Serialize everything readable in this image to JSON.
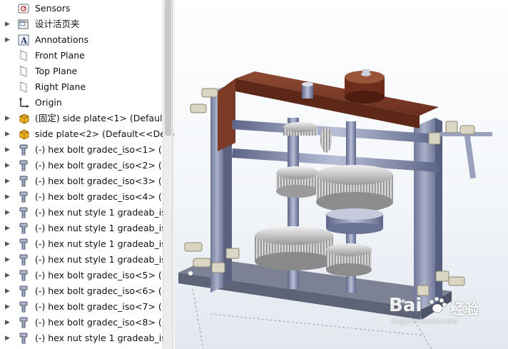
{
  "tree": {
    "items": [
      {
        "label": "Sensors",
        "icon": "sensors-folder-icon",
        "expander": "none"
      },
      {
        "label": "设计活页夹",
        "icon": "design-binder-icon",
        "expander": "collapsed"
      },
      {
        "label": "Annotations",
        "icon": "annotations-icon",
        "expander": "collapsed"
      },
      {
        "label": "Front Plane",
        "icon": "plane-icon",
        "expander": "none"
      },
      {
        "label": "Top Plane",
        "icon": "plane-icon",
        "expander": "none"
      },
      {
        "label": "Right Plane",
        "icon": "plane-icon",
        "expander": "none"
      },
      {
        "label": "Origin",
        "icon": "origin-icon",
        "expander": "none"
      },
      {
        "label": "(固定) side plate<1> (Default<",
        "icon": "part-icon",
        "expander": "collapsed"
      },
      {
        "label": "side plate<2> (Default<<Defa",
        "icon": "part-icon",
        "expander": "collapsed"
      },
      {
        "label": "(-) hex bolt gradec_iso<1> (IS(",
        "icon": "bolt-icon",
        "expander": "collapsed"
      },
      {
        "label": "(-) hex bolt gradec_iso<2> (IS(",
        "icon": "bolt-icon",
        "expander": "collapsed"
      },
      {
        "label": "(-) hex bolt gradec_iso<3> (IS(",
        "icon": "bolt-icon",
        "expander": "collapsed"
      },
      {
        "label": "(-) hex bolt gradec_iso<4> (IS(",
        "icon": "bolt-icon",
        "expander": "collapsed"
      },
      {
        "label": "(-) hex nut style 1 gradeab_iso",
        "icon": "bolt-icon",
        "expander": "collapsed"
      },
      {
        "label": "(-) hex nut style 1 gradeab_iso",
        "icon": "bolt-icon",
        "expander": "collapsed"
      },
      {
        "label": "(-) hex nut style 1 gradeab_iso",
        "icon": "bolt-icon",
        "expander": "collapsed"
      },
      {
        "label": "(-) hex nut style 1 gradeab_iso",
        "icon": "bolt-icon",
        "expander": "collapsed"
      },
      {
        "label": "(-) hex bolt gradec_iso<5> (IS(",
        "icon": "bolt-icon",
        "expander": "collapsed"
      },
      {
        "label": "(-) hex bolt gradec_iso<6> (IS(",
        "icon": "bolt-icon",
        "expander": "collapsed"
      },
      {
        "label": "(-) hex bolt gradec_iso<7> (IS(",
        "icon": "bolt-icon",
        "expander": "collapsed"
      },
      {
        "label": "(-) hex bolt gradec_iso<8> (IS(",
        "icon": "bolt-icon",
        "expander": "collapsed"
      },
      {
        "label": "(-) hex nut style 1 gradeab_iso",
        "icon": "bolt-icon",
        "expander": "collapsed"
      }
    ]
  },
  "watermark": {
    "brand": "Bai",
    "brand2": "经验",
    "sub": "jingyan.baidu.com"
  },
  "colors": {
    "plate": "#7b3a26",
    "frame": "#7f88a8",
    "gear": "#cfcfcf",
    "shaft": "#8f97b8"
  }
}
